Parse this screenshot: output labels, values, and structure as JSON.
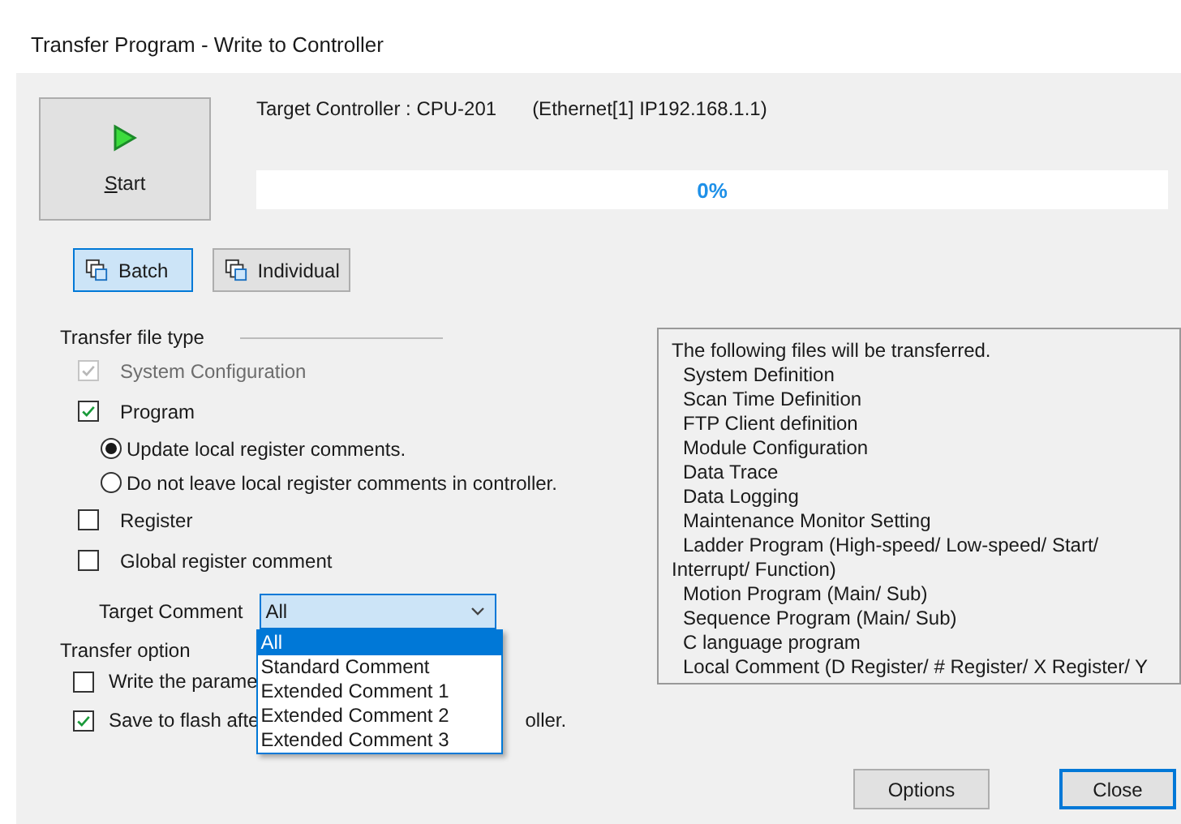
{
  "window": {
    "title": "Transfer Program - Write to Controller"
  },
  "start_button": {
    "label": "Start"
  },
  "target_controller": {
    "label": "Target Controller : CPU-201",
    "connection": "(Ethernet[1] IP192.168.1.1)"
  },
  "progress": {
    "level": 0,
    "text": "0%"
  },
  "mode_buttons": [
    {
      "label": "Batch",
      "selected": true
    },
    {
      "label": "Individual",
      "selected": false
    }
  ],
  "transfer_file_type": {
    "title": "Transfer file type",
    "items": [
      {
        "kind": "checkbox",
        "label": "System Configuration",
        "checked": true,
        "disabled": true
      },
      {
        "kind": "checkbox",
        "label": "Program",
        "checked": true,
        "disabled": false
      },
      {
        "kind": "radio",
        "label": "Update local register comments.",
        "selected": true
      },
      {
        "kind": "radio",
        "label": "Do not leave local register comments in controller.",
        "selected": false
      },
      {
        "kind": "checkbox",
        "label": "Register",
        "checked": false,
        "disabled": false
      },
      {
        "kind": "checkbox",
        "label": "Global register comment",
        "checked": false,
        "disabled": false
      }
    ]
  },
  "target_comment": {
    "label": "Target Comment",
    "value": "All",
    "expanded": true,
    "options": [
      {
        "label": "All",
        "selected": true
      },
      {
        "label": "Standard Comment",
        "selected": false
      },
      {
        "label": "Extended Comment 1",
        "selected": false
      },
      {
        "label": "Extended Comment 2",
        "selected": false
      },
      {
        "label": "Extended Comment 3",
        "selected": false
      }
    ]
  },
  "transfer_option": {
    "title": "Transfer option",
    "items": [
      {
        "label_parts": [
          "Write the parame"
        ],
        "checked": false
      },
      {
        "label_parts": [
          "Save to flash afte",
          "oller."
        ],
        "checked": true
      }
    ]
  },
  "file_list": {
    "heading": "The following files will be transferred.",
    "items": [
      "System Definition",
      "Scan Time Definition",
      "FTP Client definition",
      "Module Configuration",
      "Data Trace",
      "Data Logging",
      "Maintenance Monitor Setting",
      "Ladder Program (High-speed/ Low-speed/ Start/ Interrupt/ Function)",
      "Motion Program (Main/ Sub)",
      "Sequence Program (Main/ Sub)",
      "C language program",
      "Local Comment (D Register/ # Register/ X Register/ Y"
    ]
  },
  "buttons": [
    {
      "label": "Options",
      "focused": false
    },
    {
      "label": "Close",
      "focused": true
    }
  ]
}
